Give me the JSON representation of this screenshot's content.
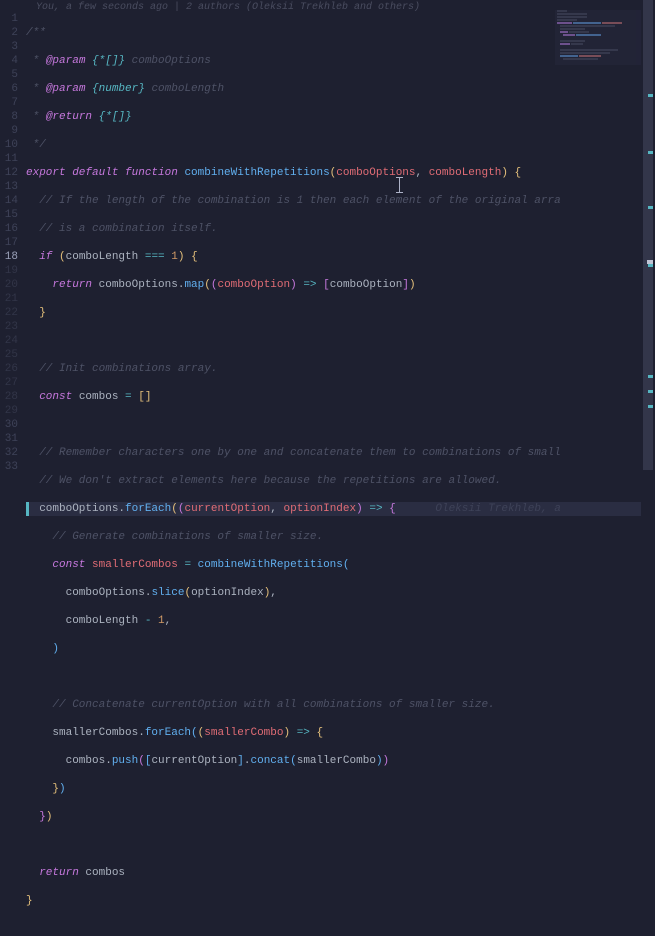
{
  "blame": "You, a few seconds ago | 2 authors (Oleksii Trekhleb and others)",
  "inline_blame_line18": "Oleksii Trekhleb, a",
  "line_numbers": [
    "1",
    "2",
    "3",
    "4",
    "5",
    "6",
    "7",
    "8",
    "9",
    "10",
    "11",
    "12",
    "13",
    "14",
    "15",
    "16",
    "17",
    "18",
    "19",
    "20",
    "21",
    "22",
    "23",
    "24",
    "25",
    "26",
    "27",
    "28",
    "29",
    "30",
    "31",
    "32",
    "33"
  ],
  "active_line": 18,
  "code": {
    "l1": "/**",
    "l2_a": " * ",
    "l2_b": "@param",
    "l2_c": " {*[]}",
    "l2_d": " comboOptions",
    "l3_a": " * ",
    "l3_b": "@param",
    "l3_c": " {number}",
    "l3_d": " comboLength",
    "l4_a": " * ",
    "l4_b": "@return",
    "l4_c": " {*[]}",
    "l5": " */",
    "l6_export": "export",
    "l6_default": " default ",
    "l6_function": "function",
    "l6_name": " combineWithRepetitions",
    "l6_p1": "comboOptions",
    "l6_p2": "comboLength",
    "l7": "  // If the length of the combination is 1 then each element of the original arra",
    "l8": "  // is a combination itself.",
    "l9_if": "  if ",
    "l9_cond_a": "comboLength ",
    "l9_op": "===",
    "l9_cond_b": " 1",
    "l10_return": "    return ",
    "l10_expr": "comboOptions",
    "l10_map": "map",
    "l10_param": "comboOption",
    "l11": "  }",
    "l13": "  // Init combinations array.",
    "l14_const": "  const ",
    "l14_name": "combos",
    "l14_eq": " = ",
    "l16": "  // Remember characters one by one and concatenate them to combinations of small",
    "l17": "  // We don't extract elements here because the repetitions are allowed.",
    "l18_obj": "  comboOptions",
    "l18_fe": "forEach",
    "l18_p1": "currentOption",
    "l18_p2": "optionIndex",
    "l19": "    // Generate combinations of smaller size.",
    "l20_const": "    const ",
    "l20_name": "smallerCombos",
    "l20_fn": "combineWithRepetitions",
    "l21_a": "      comboOptions",
    "l21_slice": "slice",
    "l21_b": "optionIndex",
    "l22_a": "      comboLength ",
    "l22_op": "-",
    "l22_b": " 1",
    "l23": "    )",
    "l25": "    // Concatenate currentOption with all combinations of smaller size.",
    "l26_obj": "    smallerCombos",
    "l26_fe": "forEach",
    "l26_p": "smallerCombo",
    "l27_a": "      combos",
    "l27_push": "push",
    "l27_b": "currentOption",
    "l27_concat": "concat",
    "l27_c": "smallerCombo",
    "l28": "    })",
    "l29": "  })",
    "l31_return": "  return ",
    "l31_val": "combos",
    "l32": "}"
  }
}
